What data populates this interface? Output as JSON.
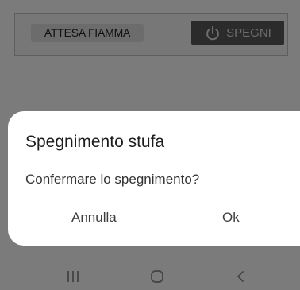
{
  "status": {
    "flame_label": "ATTESA FIAMMA",
    "power_button_label": "SPEGNI"
  },
  "dialog": {
    "title": "Spegnimento stufa",
    "message": "Confermare lo spegnimento?",
    "cancel_label": "Annulla",
    "ok_label": "Ok"
  },
  "icons": {
    "power": "power-icon",
    "recent": "recent-apps-icon",
    "home": "home-icon",
    "back": "back-icon"
  }
}
